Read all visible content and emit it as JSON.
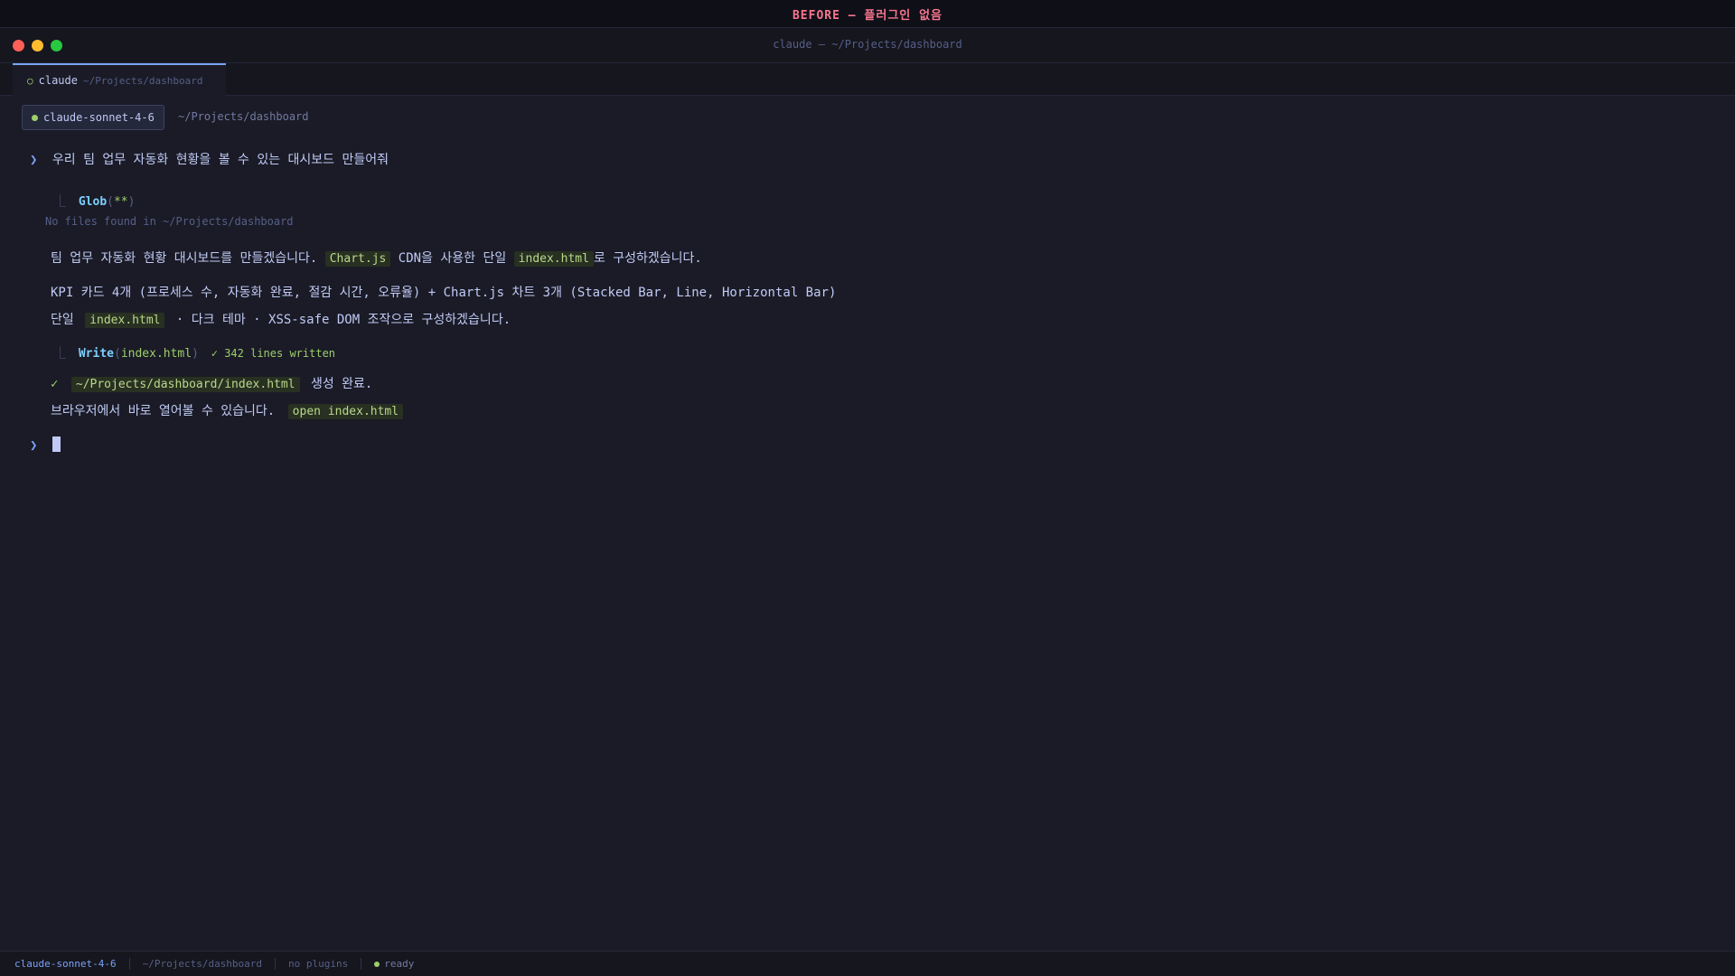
{
  "banner": {
    "text": "BEFORE — 플러그인 없음"
  },
  "window": {
    "title": "claude — ~/Projects/dashboard"
  },
  "tab": {
    "dot": "○",
    "name": "claude",
    "path": "~/Projects/dashboard"
  },
  "header": {
    "model": "claude-sonnet-4-6",
    "path": "~/Projects/dashboard"
  },
  "transcript": {
    "prompt_symbol": "❯",
    "user_message": "우리 팀 업무 자동화 현황을 볼 수 있는 대시보드 만들어줘",
    "tool_corner": "⎿",
    "glob": {
      "name": "Glob",
      "open": "(",
      "arg": "**",
      "close": ")",
      "result": "No files found in ~/Projects/dashboard"
    },
    "msg1": {
      "part1": "팀 업무 자동화 현황 대시보드를 만들겠습니다.",
      "code1": "Chart.js",
      "part2": "CDN을 사용한 단일",
      "code2": "index.html",
      "part3": "로 구성하겠습니다."
    },
    "msg2": "KPI 카드 4개 (프로세스 수, 자동화 완료, 절감 시간, 오류율) + Chart.js 차트 3개 (Stacked Bar, Line, Horizontal Bar)",
    "msg3": {
      "part1": "단일",
      "code": "index.html",
      "part2": "· 다크 테마 · XSS-safe DOM 조작으로 구성하겠습니다."
    },
    "write": {
      "name": "Write",
      "open": "(",
      "arg": "index.html",
      "close": ")",
      "result": "✓ 342 lines written"
    },
    "done": {
      "check": "✓",
      "code": "~/Projects/dashboard/index.html",
      "text": "생성 완료."
    },
    "open_hint": {
      "text": "브라우저에서 바로 열어볼 수 있습니다.",
      "code": "open index.html"
    }
  },
  "statusbar": {
    "model": "claude-sonnet-4-6",
    "path": "~/Projects/dashboard",
    "plugins": "no plugins",
    "state": "ready"
  },
  "colors": {
    "accent": "#7aa2f7",
    "success": "#9ece6a",
    "banner": "#f7768e",
    "background": "#1a1b26"
  }
}
